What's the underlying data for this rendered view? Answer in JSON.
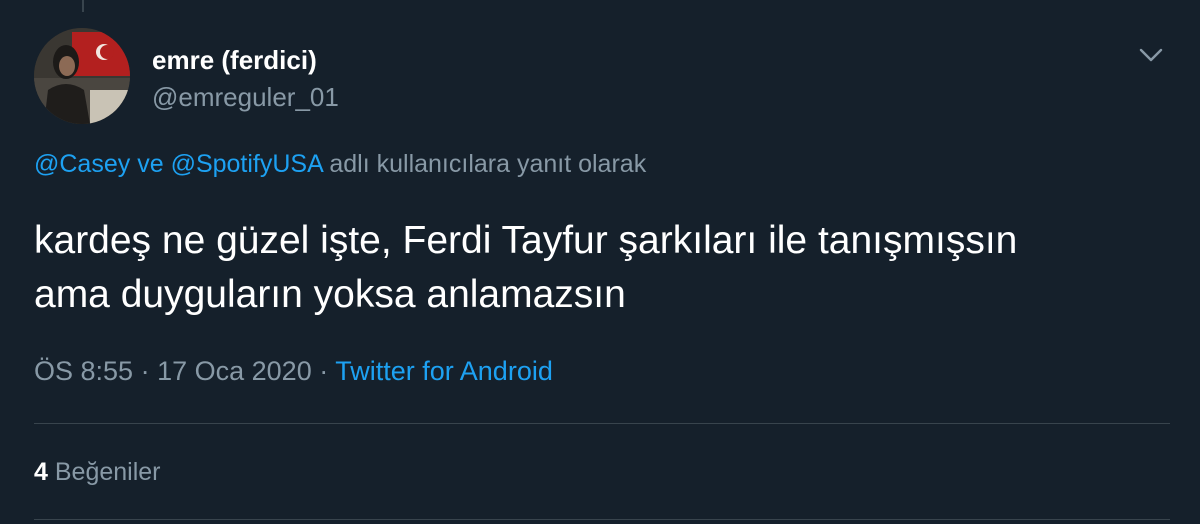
{
  "tweet": {
    "author": {
      "display_name": "emre (ferdici)",
      "handle": "@emreguler_01"
    },
    "reply_to": {
      "user1": "@Casey",
      "connector": "ve",
      "user2": "@SpotifyUSA",
      "suffix": "adlı kullanıcılara yanıt olarak"
    },
    "text_line1": "kardeş ne güzel işte, Ferdi Tayfur şarkıları ile tanışmışsın",
    "text_line2": "ama duyguların yoksa anlamazsın",
    "time": "ÖS 8:55",
    "separator": "·",
    "date": "17 Oca 2020",
    "source": "Twitter for Android",
    "likes_count": "4",
    "likes_label": "Beğeniler"
  },
  "colors": {
    "background": "#15202b",
    "accent": "#1da1f2",
    "secondary_text": "#8899a6",
    "divider": "#38444d"
  },
  "icons": {
    "menu": "chevron-down-icon"
  }
}
